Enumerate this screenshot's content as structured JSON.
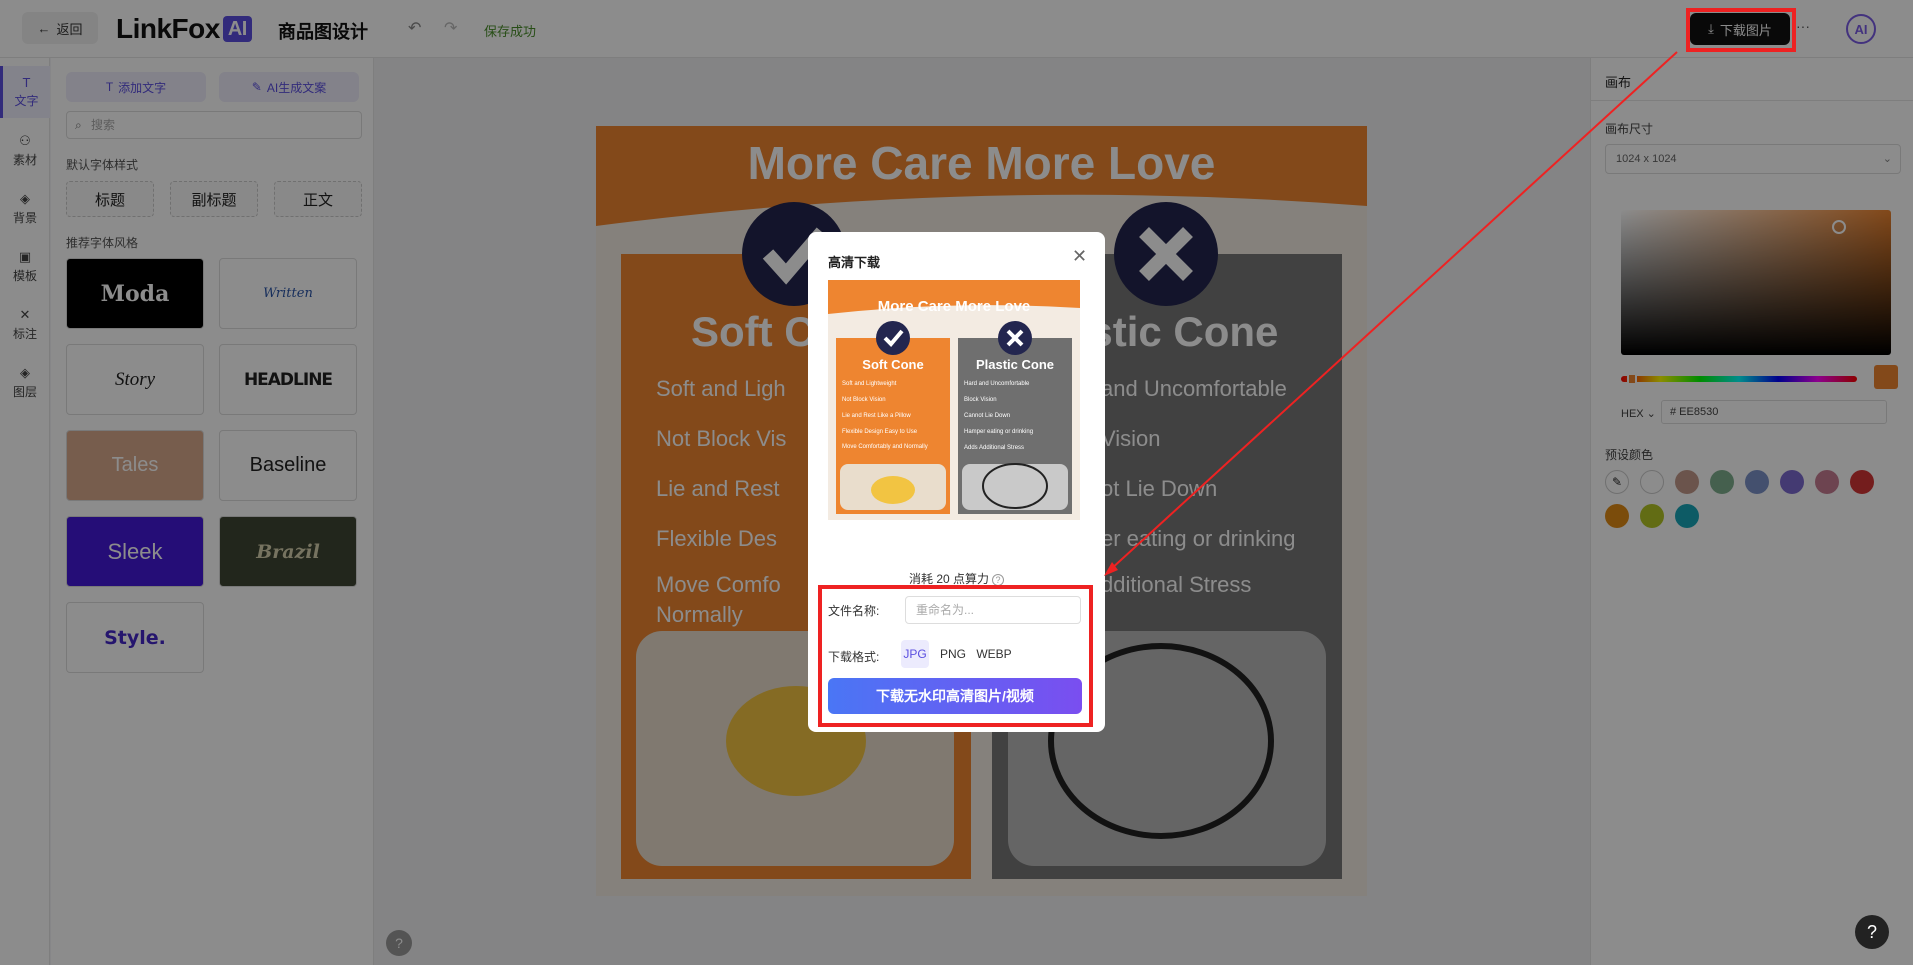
{
  "header": {
    "back_label": "返回",
    "logo_text": "LinkFox",
    "logo_ai": "AI",
    "page_title": "商品图设计",
    "save_status": "保存成功",
    "download_label": "下载图片",
    "more": "···",
    "avatar": "AI"
  },
  "rail": {
    "items": [
      {
        "label": "文字",
        "icon": "text-icon"
      },
      {
        "label": "素材",
        "icon": "material-icon"
      },
      {
        "label": "背景",
        "icon": "layers-icon"
      },
      {
        "label": "模板",
        "icon": "template-icon"
      },
      {
        "label": "标注",
        "icon": "annotate-icon"
      },
      {
        "label": "图层",
        "icon": "layers-icon"
      }
    ]
  },
  "left_panel": {
    "add_text": "添加文字",
    "ai_copy": "AI生成文案",
    "search_placeholder": "搜索",
    "default_styles_label": "默认字体样式",
    "default_styles": [
      "标题",
      "副标题",
      "正文"
    ],
    "recommended_label": "推荐字体风格",
    "font_cards": [
      "Moda",
      "Written",
      "Story",
      "HEADLINE",
      "Tales",
      "Baseline",
      "Sleek",
      "Brazil",
      "Style."
    ]
  },
  "canvas": {
    "banner": "More Care More Love",
    "left_title": "Soft C",
    "right_title": "astic Cone",
    "left_bullets": [
      "Soft and Ligh",
      "Not Block Vis",
      "Lie and Rest",
      "Flexible Des",
      "Move Comfo",
      "Normally"
    ],
    "right_bullets": [
      "and Uncomfortable",
      "Vision",
      "ot Lie Down",
      "er eating or drinking",
      "dditional Stress"
    ]
  },
  "modal": {
    "title": "高清下载",
    "preview": {
      "banner": "More Care More Love",
      "left_title": "Soft Cone",
      "right_title": "Plastic Cone",
      "left_bullets": [
        "Soft and Lightweight",
        "Not Block Vision",
        "Lie and Rest Like a Pillow",
        "Flexible Design Easy to Use",
        "Move Comfortably and Normally"
      ],
      "right_bullets": [
        "Hard and Uncomfortable",
        "Block Vision",
        "Cannot Lie Down",
        "Hamper eating or drinking",
        "Adds Additional Stress"
      ]
    },
    "cost_text": "消耗 20 点算力",
    "filename_label": "文件名称:",
    "filename_placeholder": "重命名为...",
    "format_label": "下载格式:",
    "formats": [
      "JPG",
      "PNG",
      "WEBP"
    ],
    "selected_format": "JPG",
    "download_button": "下载无水印高清图片/视频"
  },
  "right_panel": {
    "title": "画布",
    "size_label": "画布尺寸",
    "size_value": "1024 x 1024",
    "hex_label": "HEX",
    "hex_value": "# EE8530",
    "presets_label": "预设颜色",
    "colors": {
      "accent": "#EE8530",
      "presets": [
        "#ffffff",
        "#c49a8a",
        "#7fb08f",
        "#7c93c9",
        "#7d6ad0",
        "#c77d93",
        "#d43535",
        "#e08b14",
        "#b3c526",
        "#18a6b8"
      ]
    }
  },
  "help": "?"
}
